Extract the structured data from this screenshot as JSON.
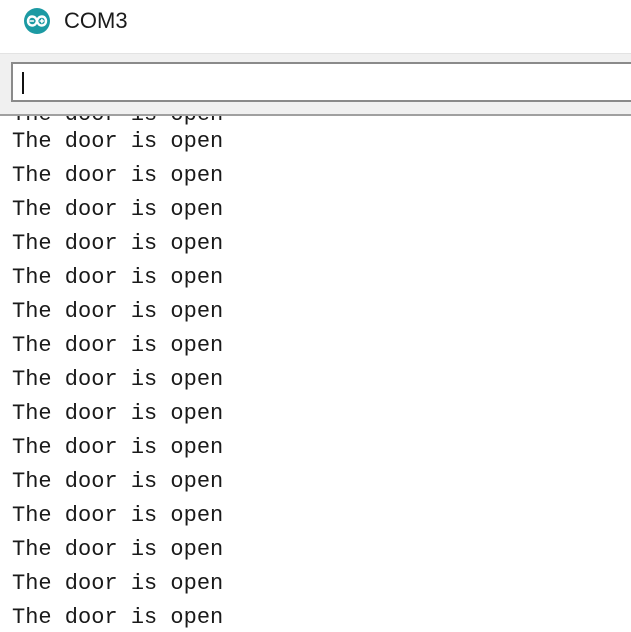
{
  "window": {
    "title": "COM3",
    "icon": "arduino-infinity-icon"
  },
  "input": {
    "value": ""
  },
  "output": {
    "partial_line": "The door is open",
    "lines": [
      "The door is open",
      "The door is open",
      "The door is open",
      "The door is open",
      "The door is open",
      "The door is open",
      "The door is open",
      "The door is open",
      "The door is open",
      "The door is open",
      "The door is open",
      "The door is open",
      "The door is open",
      "The door is open",
      "The door is open"
    ]
  },
  "colors": {
    "accent": "#1c9aa3",
    "text": "#1a1a1a",
    "input_band": "#f0f0f0"
  }
}
